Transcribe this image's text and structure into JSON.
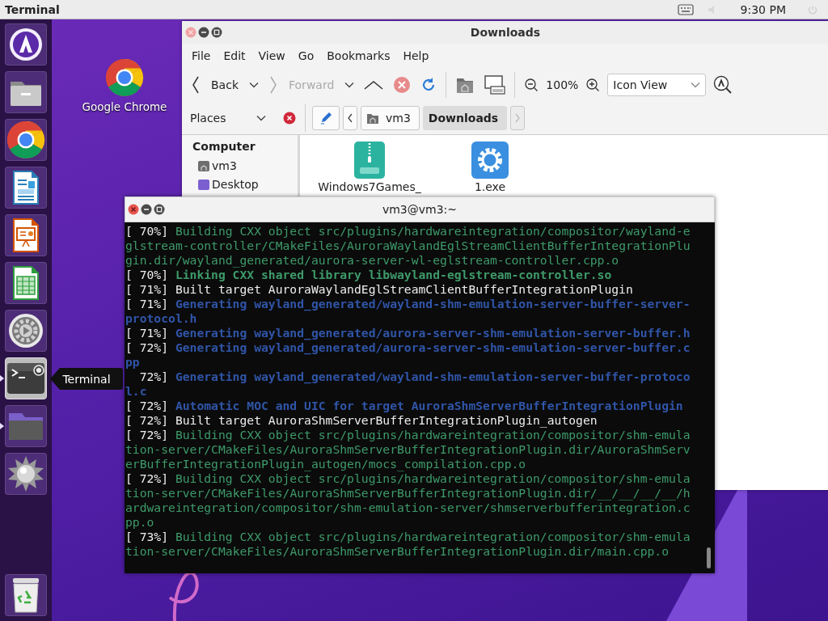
{
  "top_panel": {
    "app_title": "Terminal",
    "clock": "9:30 PM"
  },
  "dock": {
    "items": [
      {
        "kind": "arch",
        "running": false,
        "selected": false
      },
      {
        "kind": "files",
        "running": false,
        "selected": false
      },
      {
        "kind": "chrome",
        "running": false,
        "selected": false
      },
      {
        "kind": "writer",
        "running": false,
        "selected": false
      },
      {
        "kind": "impress",
        "running": false,
        "selected": false
      },
      {
        "kind": "calc",
        "running": false,
        "selected": false
      },
      {
        "kind": "settings",
        "running": false,
        "selected": false
      },
      {
        "kind": "terminal",
        "running": true,
        "selected": true
      },
      {
        "kind": "folder",
        "running": true,
        "selected": false
      },
      {
        "kind": "spiky",
        "running": false,
        "selected": false
      }
    ],
    "trash": {
      "kind": "trash"
    },
    "tooltip": "Terminal"
  },
  "desktop_icons": [
    {
      "label": "Google Chrome",
      "kind": "chrome"
    }
  ],
  "file_manager": {
    "title": "Downloads",
    "menu": [
      "File",
      "Edit",
      "View",
      "Go",
      "Bookmarks",
      "Help"
    ],
    "toolbar": {
      "back": "Back",
      "forward": "Forward",
      "forward_disabled": true,
      "zoom": "100%",
      "view_mode": "Icon View"
    },
    "places_label": "Places",
    "path": [
      {
        "label": "vm3",
        "kind": "home",
        "selected": false
      },
      {
        "label": "Downloads",
        "kind": "plain",
        "selected": true
      }
    ],
    "sidebar": {
      "heading": "Computer",
      "items": [
        {
          "label": "vm3",
          "kind": "home"
        },
        {
          "label": "Desktop",
          "kind": "desktop"
        }
      ]
    },
    "files": [
      {
        "name": "Windows7Games_",
        "kind": "zip"
      },
      {
        "name": "1.exe",
        "kind": "exe"
      }
    ]
  },
  "terminal": {
    "title": "vm3@vm3:~",
    "rows": [
      {
        "progress": "[ 70%]",
        "text": "Building CXX object src/plugins/hardwareintegration/compositor/wayland-e",
        "kind": "green"
      },
      {
        "text": "glstream-controller/CMakeFiles/AuroraWaylandEglStreamClientBufferIntegrationPlu",
        "kind": "green"
      },
      {
        "text": "gin.dir/wayland_generated/aurora-server-wl-eglstream-controller.cpp.o",
        "kind": "green"
      },
      {
        "progress": "[ 70%]",
        "text": "Linking CXX shared library libwayland-eglstream-controller.so",
        "kind": "green-bold"
      },
      {
        "progress": "[ 71%]",
        "text": "Built target AuroraWaylandEglStreamClientBufferIntegrationPlugin",
        "kind": "white"
      },
      {
        "progress": "[ 71%]",
        "text": "Generating wayland_generated/wayland-shm-emulation-server-buffer-server-",
        "kind": "blue-bold"
      },
      {
        "text": "protocol.h",
        "kind": "blue-bold"
      },
      {
        "progress": "[ 71%]",
        "text": "Generating wayland_generated/aurora-server-shm-emulation-server-buffer.h",
        "kind": "blue-bold"
      },
      {
        "progress": "[ 72%]",
        "text": "Generating wayland_generated/aurora-server-shm-emulation-server-buffer.c",
        "kind": "blue-bold"
      },
      {
        "text": "pp",
        "kind": "blue-bold"
      },
      {
        "progress": "72%]",
        "text": "Generating wayland_generated/wayland-shm-emulation-server-buffer-protoco",
        "kind": "blue-bold"
      },
      {
        "text": "l.c",
        "kind": "blue-bold"
      },
      {
        "progress": "[ 72%]",
        "text": "Automatic MOC and UIC for target AuroraShmServerBufferIntegrationPlugin",
        "kind": "blue-bold"
      },
      {
        "progress": "[ 72%]",
        "text": "Built target AuroraShmServerBufferIntegrationPlugin_autogen",
        "kind": "white"
      },
      {
        "progress": "[ 72%]",
        "text": "Building CXX object src/plugins/hardwareintegration/compositor/shm-emula",
        "kind": "green"
      },
      {
        "text": "tion-server/CMakeFiles/AuroraShmServerBufferIntegrationPlugin.dir/AuroraShmServ",
        "kind": "green"
      },
      {
        "text": "erBufferIntegrationPlugin_autogen/mocs_compilation.cpp.o",
        "kind": "green"
      },
      {
        "progress": "[ 72%]",
        "text": "Building CXX object src/plugins/hardwareintegration/compositor/shm-emula",
        "kind": "green"
      },
      {
        "text": "tion-server/CMakeFiles/AuroraShmServerBufferIntegrationPlugin.dir/__/__/__/__/h",
        "kind": "green"
      },
      {
        "text": "ardwareintegration/compositor/shm-emulation-server/shmserverbufferintegration.c",
        "kind": "green"
      },
      {
        "text": "pp.o",
        "kind": "green"
      },
      {
        "progress": "[ 73%]",
        "text": "Building CXX object src/plugins/hardwareintegration/compositor/shm-emula",
        "kind": "green"
      },
      {
        "text": "tion-server/CMakeFiles/AuroraShmServerBufferIntegrationPlugin.dir/main.cpp.o",
        "kind": "green"
      }
    ]
  }
}
